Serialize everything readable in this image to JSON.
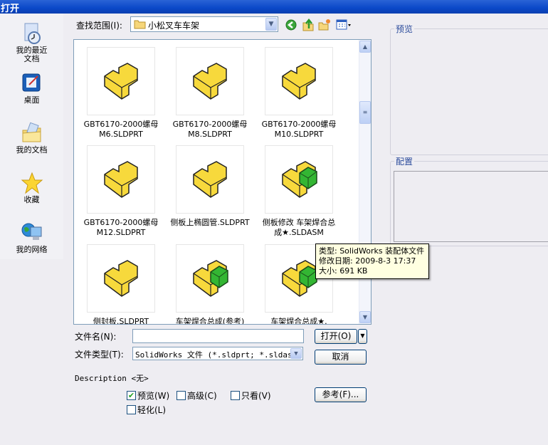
{
  "title": "打开",
  "places": [
    {
      "label": "我的最近\n文档",
      "icon": "recent-documents-icon"
    },
    {
      "label": "桌面",
      "icon": "desktop-icon"
    },
    {
      "label": "我的文档",
      "icon": "my-documents-icon"
    },
    {
      "label": "收藏",
      "icon": "favorites-icon"
    },
    {
      "label": "我的网络",
      "icon": "network-icon"
    }
  ],
  "lookin": {
    "label": "查找范围(I):",
    "value": "小松叉车车架"
  },
  "files": [
    {
      "name": "GBT6170-2000螺母\nM6.SLDPRT",
      "type": "part"
    },
    {
      "name": "GBT6170-2000螺母\nM8.SLDPRT",
      "type": "part"
    },
    {
      "name": "GBT6170-2000螺母\nM10.SLDPRT",
      "type": "part"
    },
    {
      "name": "GBT6170-2000螺母\nM12.SLDPRT",
      "type": "part"
    },
    {
      "name": "侧板上椭圆管.SLDPRT",
      "type": "part"
    },
    {
      "name": "侧板修改 车架焊合总\n成★.SLDASM",
      "type": "assembly"
    },
    {
      "name": "侧封板.SLDPRT",
      "type": "part"
    },
    {
      "name": "车架焊合总成(参考)",
      "type": "assembly"
    },
    {
      "name": "车架焊合总成★.",
      "type": "assembly"
    }
  ],
  "tooltip": {
    "line1": "类型: SolidWorks 装配体文件",
    "line2": "修改日期: 2009-8-3 17:37",
    "line3": "大小: 691 KB"
  },
  "preview_label": "预览",
  "config_label": "配置",
  "filename": {
    "label": "文件名(N):",
    "value": ""
  },
  "filetype": {
    "label": "文件类型(T):",
    "value": "SolidWorks 文件 (*.sldprt; *.sldasm;"
  },
  "buttons": {
    "open": "打开(O)",
    "cancel": "取消",
    "references": "参考(F)..."
  },
  "description": "Description <无>",
  "options": [
    {
      "label": "预览(W)",
      "checked": true
    },
    {
      "label": "高级(C)",
      "checked": false
    },
    {
      "label": "只看(V)",
      "checked": false
    },
    {
      "label": "轻化(L)",
      "checked": false
    }
  ]
}
